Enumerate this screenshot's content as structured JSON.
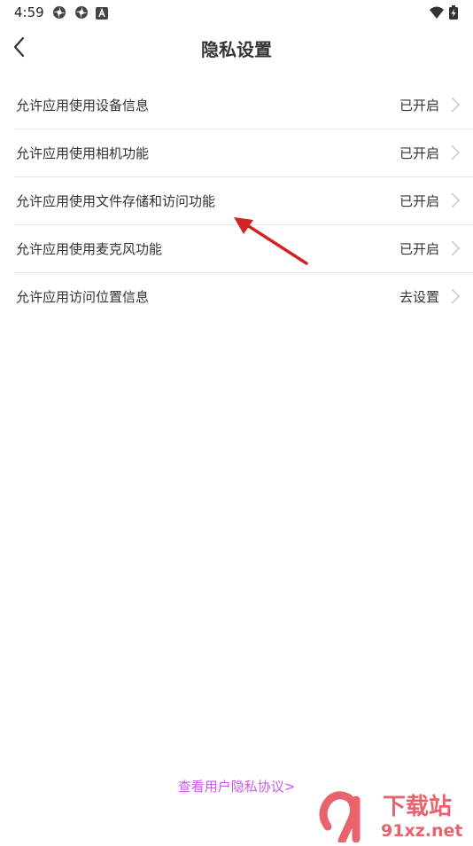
{
  "status_bar": {
    "time": "4:59",
    "icons": [
      "settings-gear-icon",
      "settings-gear-icon",
      "app-a-icon",
      "wifi-icon",
      "battery-charging-icon"
    ]
  },
  "header": {
    "back_icon": "chevron-left-icon",
    "title": "隐私设置"
  },
  "settings": [
    {
      "label": "允许应用使用设备信息",
      "status": "已开启"
    },
    {
      "label": "允许应用使用相机功能",
      "status": "已开启"
    },
    {
      "label": "允许应用使用文件存储和访问功能",
      "status": "已开启"
    },
    {
      "label": "允许应用使用麦克风功能",
      "status": "已开启"
    },
    {
      "label": "允许应用访问位置信息",
      "status": "去设置"
    }
  ],
  "footer": {
    "policy_link": "查看用户隐私协议>"
  },
  "watermark": {
    "logo_text": "下载站",
    "site_text": "91xz.net"
  },
  "colors": {
    "accent_link": "#c95be8",
    "annotation_arrow": "#d42222",
    "divider": "#e6e6e6"
  }
}
